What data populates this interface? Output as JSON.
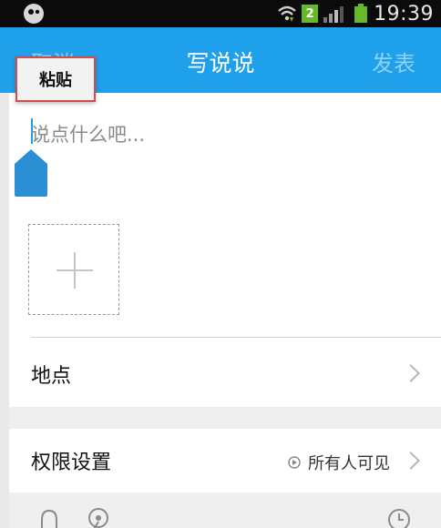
{
  "status_bar": {
    "network_badge": "2",
    "time": "19:39",
    "icons": [
      "app-notification-icon",
      "wifi-icon",
      "signal-icon",
      "battery-icon"
    ]
  },
  "title_bar": {
    "cancel_label": "取消",
    "title": "写说说",
    "publish_label": "发表",
    "color": "#1ea0ea"
  },
  "context_menu": {
    "paste_label": "粘贴"
  },
  "compose": {
    "placeholder": "说点什么吧...",
    "add_photo_icon": "plus-icon"
  },
  "location_row": {
    "label": "地点"
  },
  "permission_row": {
    "label": "权限设置",
    "value": "所有人可见"
  },
  "bottom_toolbar": {
    "icons": [
      "contact-icon",
      "location-pin-icon",
      "clock-icon"
    ]
  }
}
